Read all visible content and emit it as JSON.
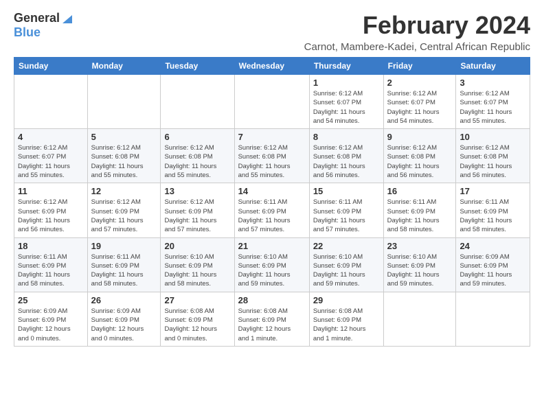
{
  "logo": {
    "general": "General",
    "blue": "Blue"
  },
  "header": {
    "month": "February 2024",
    "location": "Carnot, Mambere-Kadei, Central African Republic"
  },
  "weekdays": [
    "Sunday",
    "Monday",
    "Tuesday",
    "Wednesday",
    "Thursday",
    "Friday",
    "Saturday"
  ],
  "weeks": [
    [
      {
        "day": "",
        "info": ""
      },
      {
        "day": "",
        "info": ""
      },
      {
        "day": "",
        "info": ""
      },
      {
        "day": "",
        "info": ""
      },
      {
        "day": "1",
        "info": "Sunrise: 6:12 AM\nSunset: 6:07 PM\nDaylight: 11 hours\nand 54 minutes."
      },
      {
        "day": "2",
        "info": "Sunrise: 6:12 AM\nSunset: 6:07 PM\nDaylight: 11 hours\nand 54 minutes."
      },
      {
        "day": "3",
        "info": "Sunrise: 6:12 AM\nSunset: 6:07 PM\nDaylight: 11 hours\nand 55 minutes."
      }
    ],
    [
      {
        "day": "4",
        "info": "Sunrise: 6:12 AM\nSunset: 6:07 PM\nDaylight: 11 hours\nand 55 minutes."
      },
      {
        "day": "5",
        "info": "Sunrise: 6:12 AM\nSunset: 6:08 PM\nDaylight: 11 hours\nand 55 minutes."
      },
      {
        "day": "6",
        "info": "Sunrise: 6:12 AM\nSunset: 6:08 PM\nDaylight: 11 hours\nand 55 minutes."
      },
      {
        "day": "7",
        "info": "Sunrise: 6:12 AM\nSunset: 6:08 PM\nDaylight: 11 hours\nand 55 minutes."
      },
      {
        "day": "8",
        "info": "Sunrise: 6:12 AM\nSunset: 6:08 PM\nDaylight: 11 hours\nand 56 minutes."
      },
      {
        "day": "9",
        "info": "Sunrise: 6:12 AM\nSunset: 6:08 PM\nDaylight: 11 hours\nand 56 minutes."
      },
      {
        "day": "10",
        "info": "Sunrise: 6:12 AM\nSunset: 6:08 PM\nDaylight: 11 hours\nand 56 minutes."
      }
    ],
    [
      {
        "day": "11",
        "info": "Sunrise: 6:12 AM\nSunset: 6:09 PM\nDaylight: 11 hours\nand 56 minutes."
      },
      {
        "day": "12",
        "info": "Sunrise: 6:12 AM\nSunset: 6:09 PM\nDaylight: 11 hours\nand 57 minutes."
      },
      {
        "day": "13",
        "info": "Sunrise: 6:12 AM\nSunset: 6:09 PM\nDaylight: 11 hours\nand 57 minutes."
      },
      {
        "day": "14",
        "info": "Sunrise: 6:11 AM\nSunset: 6:09 PM\nDaylight: 11 hours\nand 57 minutes."
      },
      {
        "day": "15",
        "info": "Sunrise: 6:11 AM\nSunset: 6:09 PM\nDaylight: 11 hours\nand 57 minutes."
      },
      {
        "day": "16",
        "info": "Sunrise: 6:11 AM\nSunset: 6:09 PM\nDaylight: 11 hours\nand 58 minutes."
      },
      {
        "day": "17",
        "info": "Sunrise: 6:11 AM\nSunset: 6:09 PM\nDaylight: 11 hours\nand 58 minutes."
      }
    ],
    [
      {
        "day": "18",
        "info": "Sunrise: 6:11 AM\nSunset: 6:09 PM\nDaylight: 11 hours\nand 58 minutes."
      },
      {
        "day": "19",
        "info": "Sunrise: 6:11 AM\nSunset: 6:09 PM\nDaylight: 11 hours\nand 58 minutes."
      },
      {
        "day": "20",
        "info": "Sunrise: 6:10 AM\nSunset: 6:09 PM\nDaylight: 11 hours\nand 58 minutes."
      },
      {
        "day": "21",
        "info": "Sunrise: 6:10 AM\nSunset: 6:09 PM\nDaylight: 11 hours\nand 59 minutes."
      },
      {
        "day": "22",
        "info": "Sunrise: 6:10 AM\nSunset: 6:09 PM\nDaylight: 11 hours\nand 59 minutes."
      },
      {
        "day": "23",
        "info": "Sunrise: 6:10 AM\nSunset: 6:09 PM\nDaylight: 11 hours\nand 59 minutes."
      },
      {
        "day": "24",
        "info": "Sunrise: 6:09 AM\nSunset: 6:09 PM\nDaylight: 11 hours\nand 59 minutes."
      }
    ],
    [
      {
        "day": "25",
        "info": "Sunrise: 6:09 AM\nSunset: 6:09 PM\nDaylight: 12 hours\nand 0 minutes."
      },
      {
        "day": "26",
        "info": "Sunrise: 6:09 AM\nSunset: 6:09 PM\nDaylight: 12 hours\nand 0 minutes."
      },
      {
        "day": "27",
        "info": "Sunrise: 6:08 AM\nSunset: 6:09 PM\nDaylight: 12 hours\nand 0 minutes."
      },
      {
        "day": "28",
        "info": "Sunrise: 6:08 AM\nSunset: 6:09 PM\nDaylight: 12 hours\nand 1 minute."
      },
      {
        "day": "29",
        "info": "Sunrise: 6:08 AM\nSunset: 6:09 PM\nDaylight: 12 hours\nand 1 minute."
      },
      {
        "day": "",
        "info": ""
      },
      {
        "day": "",
        "info": ""
      }
    ]
  ]
}
